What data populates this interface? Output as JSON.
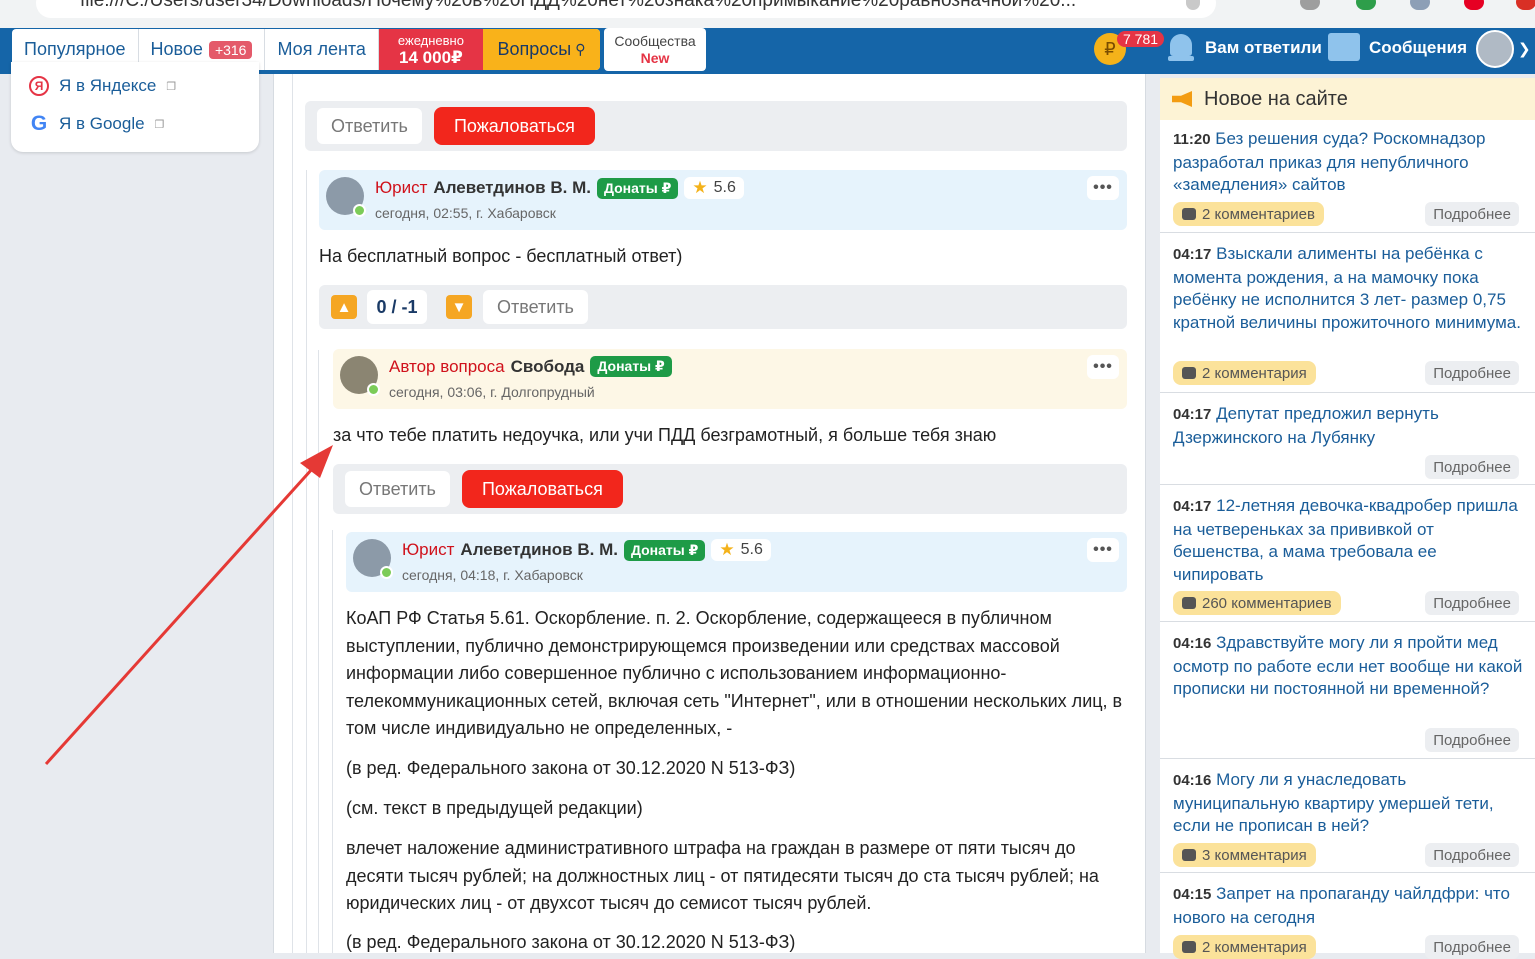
{
  "browser": {
    "url": "file:///C:/Users/user34/Downloads/Почему%20в%20ПДД%20нет%20знака%20примыкание%20равнозначной%20..."
  },
  "nav": {
    "tabs": [
      {
        "label": "Популярное"
      },
      {
        "label": "Новое",
        "count": "+316"
      },
      {
        "label": "Моя лента"
      }
    ],
    "promo_line1": "ежедневно",
    "promo_line2": "14 000₽",
    "questions": "Вопросы",
    "communities_line1": "Сообщества",
    "communities_line2": "New",
    "coin_symbol": "₽",
    "coin_count": "7 781",
    "answered": "Вам ответили",
    "messages": "Сообщения"
  },
  "left_links": [
    {
      "label": "Я в Яндексе"
    },
    {
      "label": "Я в Google"
    }
  ],
  "posts": {
    "top_actions": {
      "reply": "Ответить",
      "complain": "Пожаловаться"
    },
    "lawyer1": {
      "role": "Юрист",
      "name": "Алеветдинов В. М.",
      "donate": "Донаты ₽",
      "rating": "5.6",
      "meta": "сегодня, 02:55,  г. Хабаровск",
      "text": "На бесплатный вопрос - бесплатный ответ)",
      "score": "0 / -1",
      "reply": "Ответить"
    },
    "author": {
      "role": "Автор вопроса",
      "name": "Свобода",
      "donate": "Донаты ₽",
      "meta": "сегодня, 03:06,  г. Долгопрудный",
      "text": "за что тебе платить недоучка, или учи ПДД безграмотный, я больше тебя знаю",
      "reply": "Ответить",
      "complain": "Пожаловаться"
    },
    "lawyer2": {
      "role": "Юрист",
      "name": "Алеветдинов В. М.",
      "donate": "Донаты ₽",
      "rating": "5.6",
      "meta": "сегодня, 04:18,  г. Хабаровск",
      "paragraphs": [
        "КоАП РФ Статья 5.61. Оскорбление. п. 2. Оскорбление, содержащееся в публичном выступлении, публично демонстрирующемся произведении или средствах массовой информации либо совершенное публично с использованием информационно-телекоммуникационных сетей, включая сеть \"Интернет\", или в отношении нескольких лиц, в том числе индивидуально не определенных, -",
        "(в ред. Федерального закона от 30.12.2020 N 513-ФЗ)",
        "(см. текст в предыдущей редакции)",
        "влечет наложение административного штрафа на граждан в размере от пяти тысяч до десяти тысяч рублей; на должностных лиц - от пятидесяти тысяч до ста тысяч рублей; на юридических лиц - от двухсот тысяч до семисот тысяч рублей.",
        "(в ред. Федерального закона от 30.12.2020 N 513-ФЗ)"
      ]
    }
  },
  "sidebar": {
    "title": "Новое на сайте",
    "more_label": "Подробнее",
    "news": [
      {
        "time": "11:20",
        "title": "Без решения суда? Роскомнадзор разработал приказ для непубличного «замедления» сайтов",
        "comments": "2 комментариев"
      },
      {
        "time": "04:17",
        "title": "Взыскали алименты на ребёнка с момента рождения, а на мамочку пока ребёнку не исполнится 3 лет- размер 0,75 кратной величины прожиточного минимума.",
        "comments": "2 комментария"
      },
      {
        "time": "04:17",
        "title": "Депутат предложил вернуть Дзержинского на Лубянку",
        "comments": ""
      },
      {
        "time": "04:17",
        "title": "12-летняя девочка-квадробер пришла на четвереньках за прививкой от бешенства, а мама требовала ее чипировать",
        "comments": "260 комментариев"
      },
      {
        "time": "04:16",
        "title": "Здравствуйте могу ли я пройти мед осмотр по работе если нет вообще ни какой прописки ни постоянной ни временной?",
        "comments": ""
      },
      {
        "time": "04:16",
        "title": "Могу ли я унаследовать муниципальную квартиру умершей тети, если не прописан в ней?",
        "comments": "3 комментария"
      },
      {
        "time": "04:15",
        "title": "Запрет на пропаганду чайлдфри: что нового на сегодня",
        "comments": "2 комментария"
      }
    ]
  },
  "colors": {
    "nav_bg": "#1565a8",
    "danger": "#f2261c",
    "donate": "#1e9b47",
    "arrow": "#e53935"
  }
}
